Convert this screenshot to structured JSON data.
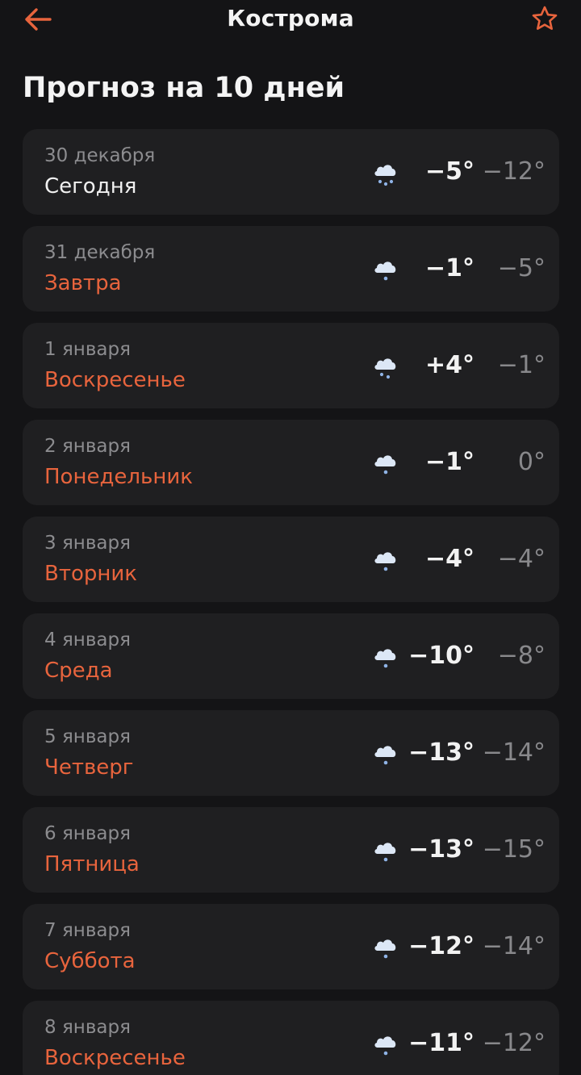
{
  "header": {
    "city": "Кострома",
    "back_icon": "arrow-left-icon",
    "favorite_icon": "star-outline-icon"
  },
  "title": "Прогноз на 10 дней",
  "colors": {
    "accent": "#e8643d",
    "background": "#141416",
    "card": "#1f1f21",
    "snow": "#8fb3e6",
    "cloud": "#dce7f6"
  },
  "days": [
    {
      "date": "30 декабря",
      "name": "Сегодня",
      "day_temp": "−5°",
      "night_temp": "−12°",
      "icon": "heavy-snow-icon",
      "today": true
    },
    {
      "date": "31 декабря",
      "name": "Завтра",
      "day_temp": "−1°",
      "night_temp": "−5°",
      "icon": "light-snow-icon",
      "today": false
    },
    {
      "date": "1 января",
      "name": "Воскресенье",
      "day_temp": "+4°",
      "night_temp": "−1°",
      "icon": "snow-icon",
      "today": false
    },
    {
      "date": "2 января",
      "name": "Понедельник",
      "day_temp": "−1°",
      "night_temp": "0°",
      "icon": "light-snow-icon",
      "today": false
    },
    {
      "date": "3 января",
      "name": "Вторник",
      "day_temp": "−4°",
      "night_temp": "−4°",
      "icon": "light-snow-icon",
      "today": false
    },
    {
      "date": "4 января",
      "name": "Среда",
      "day_temp": "−10°",
      "night_temp": "−8°",
      "icon": "light-snow-icon",
      "today": false
    },
    {
      "date": "5 января",
      "name": "Четверг",
      "day_temp": "−13°",
      "night_temp": "−14°",
      "icon": "light-snow-icon",
      "today": false
    },
    {
      "date": "6 января",
      "name": "Пятница",
      "day_temp": "−13°",
      "night_temp": "−15°",
      "icon": "light-snow-icon",
      "today": false
    },
    {
      "date": "7 января",
      "name": "Суббота",
      "day_temp": "−12°",
      "night_temp": "−14°",
      "icon": "light-snow-icon",
      "today": false
    },
    {
      "date": "8 января",
      "name": "Воскресенье",
      "day_temp": "−11°",
      "night_temp": "−12°",
      "icon": "light-snow-icon",
      "today": false
    }
  ]
}
